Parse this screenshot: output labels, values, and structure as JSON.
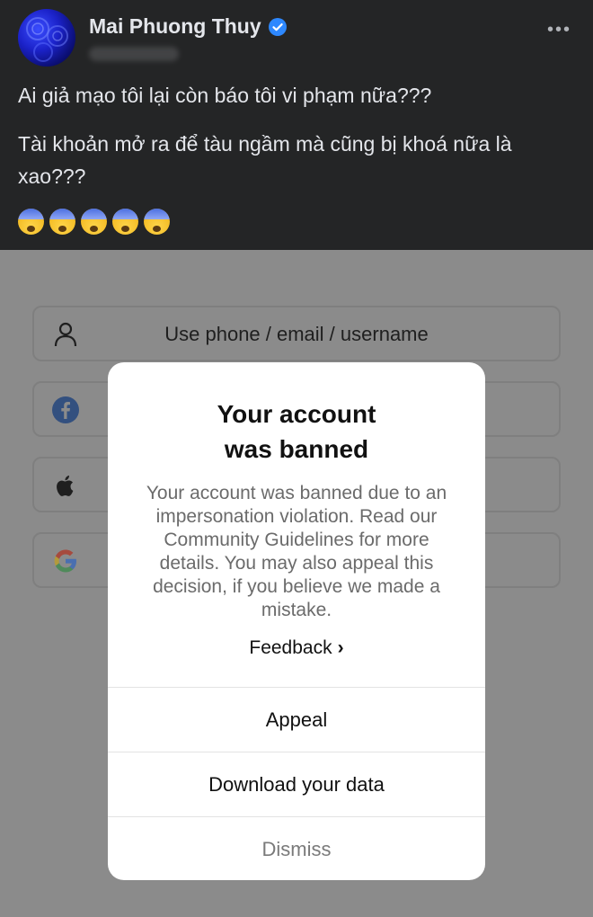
{
  "post": {
    "author": "Mai Phuong Thuy",
    "paragraphs": [
      "Ai giả mạo tôi lại còn báo tôi vi phạm nữa???",
      "Tài khoản mở ra để tàu ngầm mà cũng bị khoá nữa là xao???"
    ],
    "emoji_count": 5,
    "emoji_name": "fearful-face"
  },
  "login": {
    "options": [
      {
        "label": "Use phone / email / username",
        "icon": "person-icon"
      },
      {
        "label": "",
        "icon": "facebook-icon"
      },
      {
        "label": "",
        "icon": "apple-icon"
      },
      {
        "label": "",
        "icon": "google-icon"
      }
    ]
  },
  "modal": {
    "title_line1": "Your account",
    "title_line2": "was banned",
    "body": "Your account was banned due to an impersonation violation. Read our Community Guidelines for more details. You may also appeal this decision, if you believe we made a mistake.",
    "feedback_label": "Feedback",
    "appeal_label": "Appeal",
    "download_label": "Download your data",
    "dismiss_label": "Dismiss"
  },
  "colors": {
    "post_background": "#242526",
    "verified_badge": "#2d88ff",
    "overlay": "#8b8b8b"
  }
}
